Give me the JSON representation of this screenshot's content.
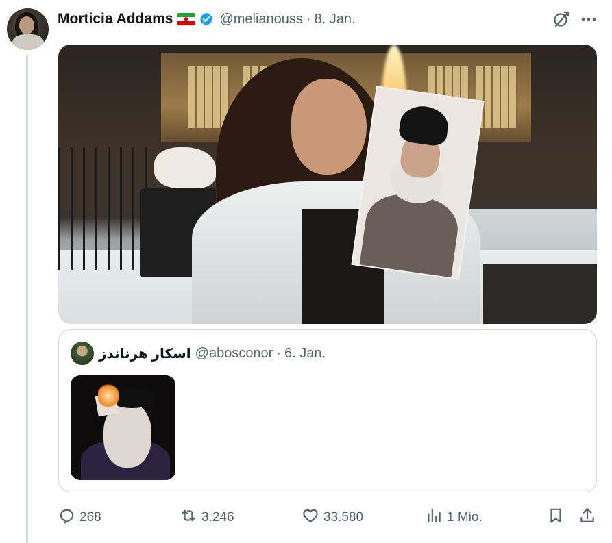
{
  "author": {
    "display_name": "Morticia Addams",
    "flag_icon": "iran-flag-icon",
    "verified_icon": "verified-badge-icon",
    "handle": "@melianouss",
    "separator": "·",
    "date": "8. Jan."
  },
  "header_actions": {
    "grok_icon": "grok-icon",
    "more_icon": "more-icon"
  },
  "quoted_tweet": {
    "display_name": "اسکار هرناندز",
    "handle": "@abosconor",
    "separator": "·",
    "date": "6. Jan."
  },
  "actions": {
    "replies": "268",
    "reposts": "3.246",
    "likes": "33.580",
    "views": "1 Mio."
  },
  "colors": {
    "text": "#0f1419",
    "secondary": "#536471",
    "verified_blue": "#1d9bf0",
    "border": "#cfd9de"
  }
}
